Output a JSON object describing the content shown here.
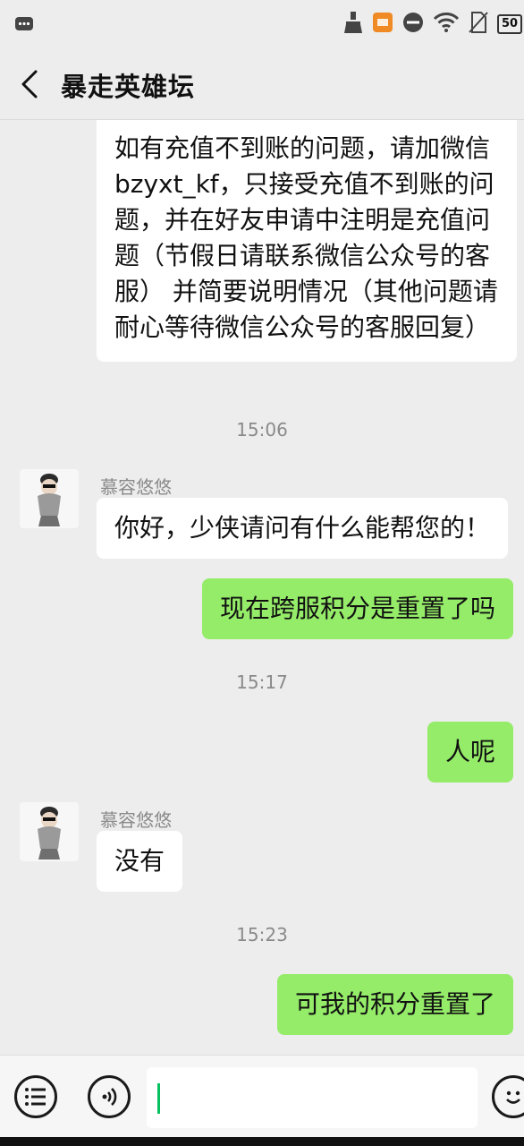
{
  "status_bar": {
    "icons": [
      "chat-bubble-icon",
      "broom-icon",
      "app-badge-icon",
      "do-not-disturb-icon",
      "wifi-icon",
      "no-sim-icon",
      "battery-icon"
    ],
    "battery": "50"
  },
  "header": {
    "title": "暴走英雄坛"
  },
  "messages": {
    "first": "如有充值不到账的问题，请加微信bzyxt_kf，只接受充值不到账的问题，并在好友申请中注明是充值问题（节假日请联系微信公众号的客服） 并简要说明情况（其他问题请耐心等待微信公众号的客服回复）",
    "ts1": "15:06",
    "sender1": "慕容悠悠",
    "reply1": "你好，少侠请问有什么能帮您的！",
    "sent1": "现在跨服积分是重置了吗",
    "ts2": "15:17",
    "sent2": "人呢",
    "sender2": "慕容悠悠",
    "reply2": "没有",
    "ts3": "15:23",
    "sent3": "可我的积分重置了"
  },
  "input_bar": {
    "value": ""
  },
  "colors": {
    "sent_bubble": "#95ec69",
    "received_bubble": "#ffffff",
    "background": "#ededed",
    "caret": "#07c160"
  }
}
